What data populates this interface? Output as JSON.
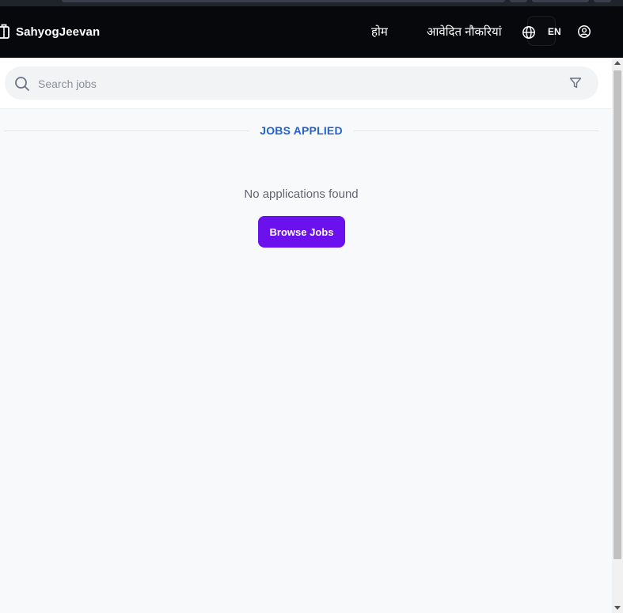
{
  "app": {
    "brand_name": "SahyogJeevan",
    "brand_icon": "briefcase-icon"
  },
  "nav": {
    "home_label": "होम",
    "applied_jobs_label": "आवेदित नौकरियां",
    "language_icon": "globe-icon",
    "language_label": "EN",
    "profile_icon": "user-circle-icon"
  },
  "search": {
    "placeholder": "Search jobs",
    "value": "",
    "search_icon": "search-icon",
    "filter_icon": "filter-icon"
  },
  "section": {
    "title": "JOBS APPLIED"
  },
  "empty_state": {
    "message": "No applications found",
    "button_label": "Browse Jobs"
  },
  "colors": {
    "navbar_bg": "#07080b",
    "accent_title": "#2563c9",
    "button_bg": "#6b11ee",
    "page_bg": "#f8f9fb"
  }
}
